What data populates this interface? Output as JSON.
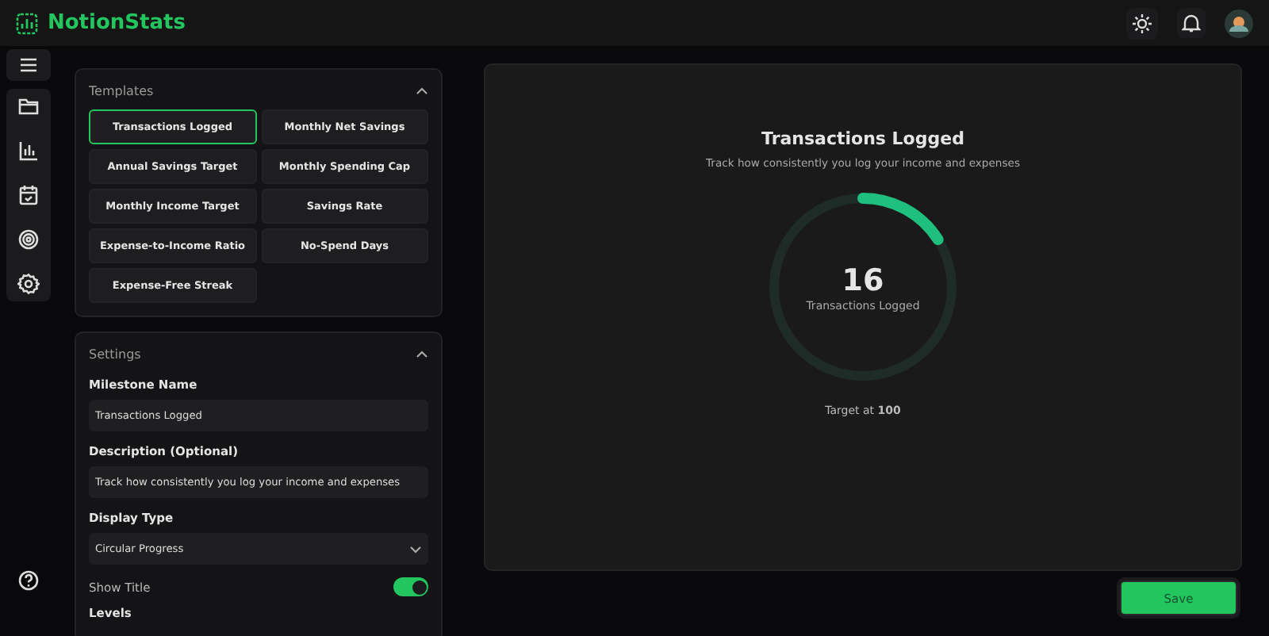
{
  "header": {
    "app_name": "NotionStats"
  },
  "templates": {
    "title": "Templates",
    "expanded": true,
    "items": [
      {
        "label": "Transactions Logged",
        "selected": true
      },
      {
        "label": "Monthly Net Savings",
        "selected": false
      },
      {
        "label": "Annual Savings Target",
        "selected": false
      },
      {
        "label": "Monthly Spending Cap",
        "selected": false
      },
      {
        "label": "Monthly Income Target",
        "selected": false
      },
      {
        "label": "Savings Rate",
        "selected": false
      },
      {
        "label": "Expense-to-Income Ratio",
        "selected": false
      },
      {
        "label": "No-Spend Days",
        "selected": false
      },
      {
        "label": "Expense-Free Streak",
        "selected": false
      }
    ]
  },
  "settings": {
    "title": "Settings",
    "expanded": true,
    "milestone_name": {
      "label": "Milestone Name",
      "value": "Transactions Logged"
    },
    "description": {
      "label": "Description (Optional)",
      "value": "Track how consistently you log your income and expenses"
    },
    "display_type": {
      "label": "Display Type",
      "value": "Circular Progress"
    },
    "show_title": {
      "label": "Show Title",
      "on": true
    },
    "levels": {
      "label": "Levels"
    }
  },
  "preview": {
    "title": "Transactions Logged",
    "subtitle": "Track how consistently you log your income and expenses",
    "value": "16",
    "value_label": "Transactions Logged",
    "level": 0.16,
    "target": "Target at **100**"
  },
  "save_button": {
    "label": "Save"
  }
}
